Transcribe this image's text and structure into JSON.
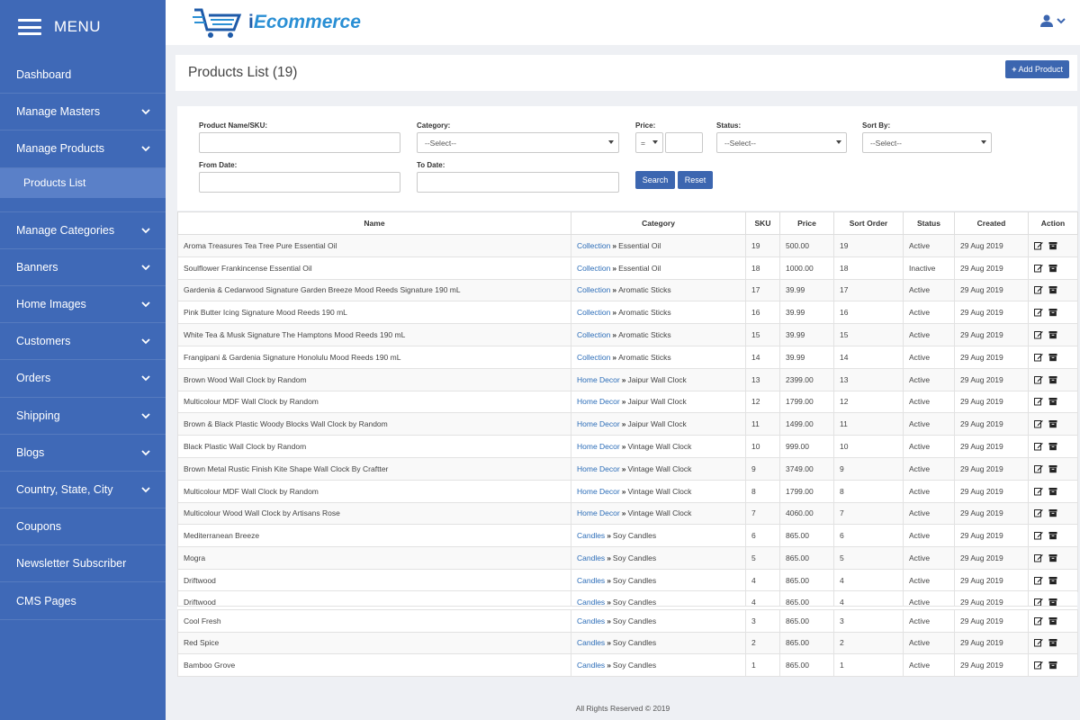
{
  "sidebar": {
    "menu_label": "MENU",
    "items": [
      {
        "label": "Dashboard",
        "chevron": false
      },
      {
        "label": "Manage Masters",
        "chevron": true
      },
      {
        "label": "Manage Products",
        "chevron": true
      },
      {
        "label": "Manage Categories",
        "chevron": true
      },
      {
        "label": "Banners",
        "chevron": true
      },
      {
        "label": "Home Images",
        "chevron": true
      },
      {
        "label": "Customers",
        "chevron": true
      },
      {
        "label": "Orders",
        "chevron": true
      },
      {
        "label": "Shipping",
        "chevron": true
      },
      {
        "label": "Blogs",
        "chevron": true
      },
      {
        "label": "Country, State, City",
        "chevron": true
      },
      {
        "label": "Coupons",
        "chevron": false
      },
      {
        "label": "Newsletter Subscriber",
        "chevron": false
      },
      {
        "label": "CMS Pages",
        "chevron": false
      }
    ],
    "sub_item": "Products List"
  },
  "header": {
    "logo_prefix": "i",
    "logo_text": "Ecommerce",
    "user_icon": "user-icon"
  },
  "page": {
    "title": "Products List (19)",
    "add_button": "Add Product"
  },
  "filters": {
    "name_label": "Product Name/SKU:",
    "name_value": "",
    "category_label": "Category:",
    "category_value": "--Select--",
    "price_label": "Price:",
    "price_op": "=",
    "price_value": "",
    "status_label": "Status:",
    "status_value": "--Select--",
    "sort_label": "Sort By:",
    "sort_value": "--Select--",
    "from_label": "From Date:",
    "from_value": "",
    "to_label": "To Date:",
    "to_value": "",
    "search_button": "Search",
    "reset_button": "Reset"
  },
  "table": {
    "headers": [
      "Name",
      "Category",
      "SKU",
      "Price",
      "Sort Order",
      "Status",
      "Created",
      "Action"
    ],
    "rows": [
      {
        "name": "Aroma Treasures Tea Tree Pure Essential Oil",
        "parent": "Collection",
        "category": "Essential Oil",
        "sku": "19",
        "price": "500.00",
        "sort": "19",
        "status": "Active",
        "created": "29 Aug 2019"
      },
      {
        "name": "Soulflower Frankincense Essential Oil",
        "parent": "Collection",
        "category": "Essential Oil",
        "sku": "18",
        "price": "1000.00",
        "sort": "18",
        "status": "Inactive",
        "created": "29 Aug 2019"
      },
      {
        "name": "Gardenia & Cedarwood Signature Garden Breeze Mood Reeds Signature 190 mL",
        "parent": "Collection",
        "category": "Aromatic Sticks",
        "sku": "17",
        "price": "39.99",
        "sort": "17",
        "status": "Active",
        "created": "29 Aug 2019"
      },
      {
        "name": "Pink Butter Icing Signature Mood Reeds 190 mL",
        "parent": "Collection",
        "category": "Aromatic Sticks",
        "sku": "16",
        "price": "39.99",
        "sort": "16",
        "status": "Active",
        "created": "29 Aug 2019"
      },
      {
        "name": "White Tea & Musk Signature The Hamptons Mood Reeds 190 mL",
        "parent": "Collection",
        "category": "Aromatic Sticks",
        "sku": "15",
        "price": "39.99",
        "sort": "15",
        "status": "Active",
        "created": "29 Aug 2019"
      },
      {
        "name": "Frangipani & Gardenia Signature Honolulu Mood Reeds 190 mL",
        "parent": "Collection",
        "category": "Aromatic Sticks",
        "sku": "14",
        "price": "39.99",
        "sort": "14",
        "status": "Active",
        "created": "29 Aug 2019"
      },
      {
        "name": "Brown Wood Wall Clock by Random",
        "parent": "Home Decor",
        "category": "Jaipur Wall Clock",
        "sku": "13",
        "price": "2399.00",
        "sort": "13",
        "status": "Active",
        "created": "29 Aug 2019"
      },
      {
        "name": "Multicolour MDF Wall Clock by Random",
        "parent": "Home Decor",
        "category": "Jaipur Wall Clock",
        "sku": "12",
        "price": "1799.00",
        "sort": "12",
        "status": "Active",
        "created": "29 Aug 2019"
      },
      {
        "name": "Brown & Black Plastic Woody Blocks Wall Clock by Random",
        "parent": "Home Decor",
        "category": "Jaipur Wall Clock",
        "sku": "11",
        "price": "1499.00",
        "sort": "11",
        "status": "Active",
        "created": "29 Aug 2019"
      },
      {
        "name": "Black Plastic Wall Clock by Random",
        "parent": "Home Decor",
        "category": "Vintage Wall Clock",
        "sku": "10",
        "price": "999.00",
        "sort": "10",
        "status": "Active",
        "created": "29 Aug 2019"
      },
      {
        "name": "Brown Metal Rustic Finish Kite Shape Wall Clock By Craftter",
        "parent": "Home Decor",
        "category": "Vintage Wall Clock",
        "sku": "9",
        "price": "3749.00",
        "sort": "9",
        "status": "Active",
        "created": "29 Aug 2019"
      },
      {
        "name": "Multicolour MDF Wall Clock by Random",
        "parent": "Home Decor",
        "category": "Vintage Wall Clock",
        "sku": "8",
        "price": "1799.00",
        "sort": "8",
        "status": "Active",
        "created": "29 Aug 2019"
      },
      {
        "name": "Multicolour Wood Wall Clock by Artisans Rose",
        "parent": "Home Decor",
        "category": "Vintage Wall Clock",
        "sku": "7",
        "price": "4060.00",
        "sort": "7",
        "status": "Active",
        "created": "29 Aug 2019"
      },
      {
        "name": "Mediterranean Breeze",
        "parent": "Candles",
        "category": "Soy Candles",
        "sku": "6",
        "price": "865.00",
        "sort": "6",
        "status": "Active",
        "created": "29 Aug 2019"
      },
      {
        "name": "Mogra",
        "parent": "Candles",
        "category": "Soy Candles",
        "sku": "5",
        "price": "865.00",
        "sort": "5",
        "status": "Active",
        "created": "29 Aug 2019"
      },
      {
        "name": "Driftwood",
        "parent": "Candles",
        "category": "Soy Candles",
        "sku": "4",
        "price": "865.00",
        "sort": "4",
        "status": "Active",
        "created": "29 Aug 2019"
      }
    ],
    "ghost_row": {
      "name": "Driftwood",
      "parent": "Candles",
      "category": "Soy Candles",
      "sku": "4",
      "price": "865.00",
      "sort": "4",
      "status": "Active",
      "created": "29 Aug 2019"
    },
    "rows_after": [
      {
        "name": "Cool Fresh",
        "parent": "Candles",
        "category": "Soy Candles",
        "sku": "3",
        "price": "865.00",
        "sort": "3",
        "status": "Active",
        "created": "29 Aug 2019"
      },
      {
        "name": "Red Spice",
        "parent": "Candles",
        "category": "Soy Candles",
        "sku": "2",
        "price": "865.00",
        "sort": "2",
        "status": "Active",
        "created": "29 Aug 2019"
      },
      {
        "name": "Bamboo Grove",
        "parent": "Candles",
        "category": "Soy Candles",
        "sku": "1",
        "price": "865.00",
        "sort": "1",
        "status": "Active",
        "created": "29 Aug 2019"
      }
    ]
  },
  "footer": {
    "text": "All Rights Reserved © 2019"
  },
  "colors": {
    "sidebar": "#3f69b7",
    "sub_item": "#5a80c8",
    "primary_button": "#3c66b0",
    "link": "#2c6db8"
  }
}
